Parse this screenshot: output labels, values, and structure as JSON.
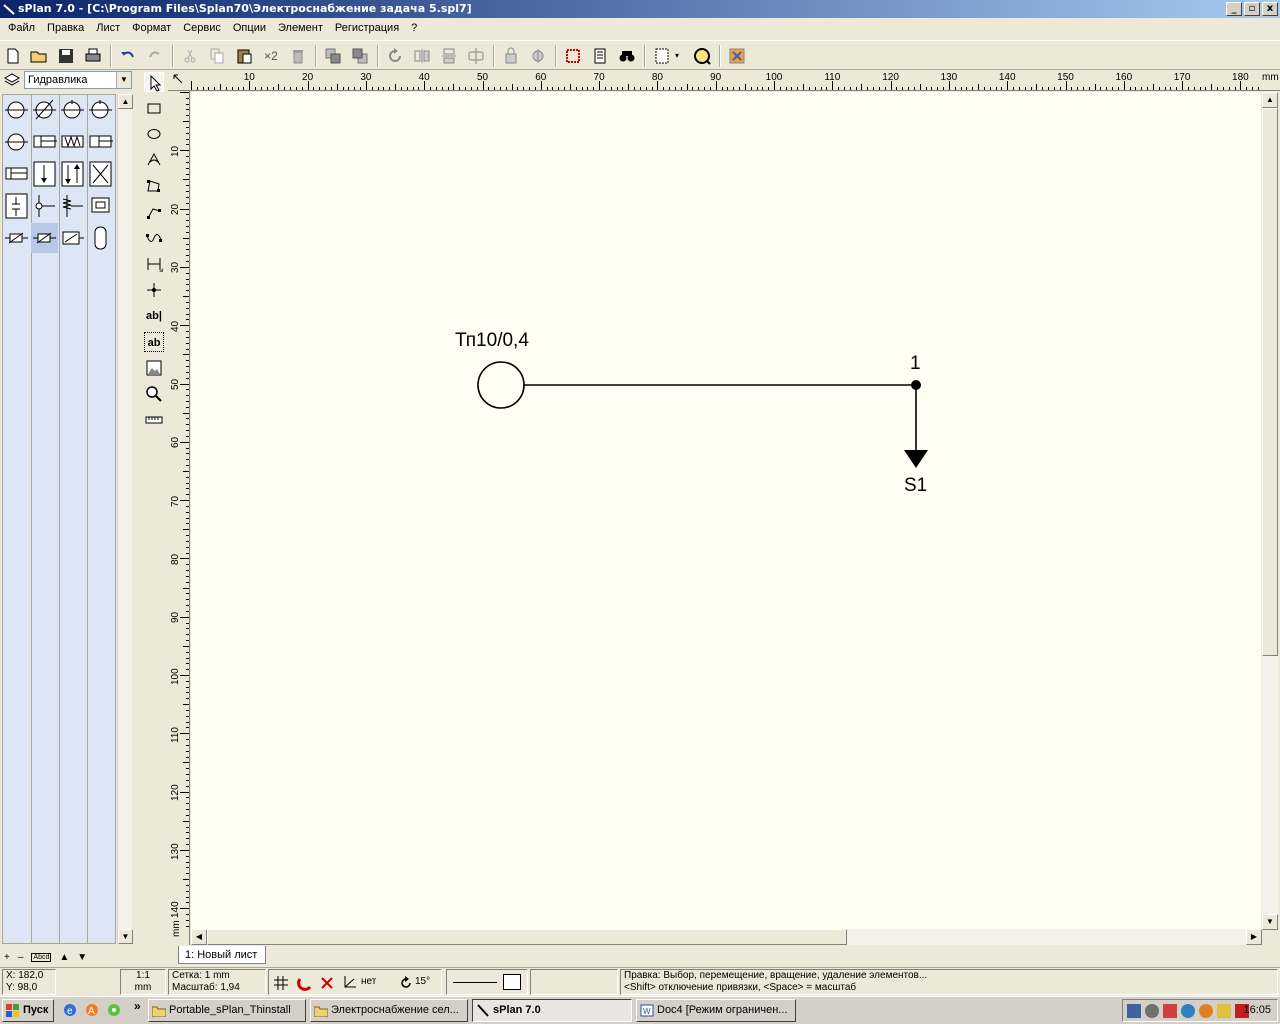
{
  "window": {
    "title": "sPlan 7.0 - [C:\\Program Files\\Splan70\\Электроснабжение задача 5.spl7]",
    "controls": [
      "_",
      "▫",
      "x"
    ]
  },
  "menu": {
    "items": [
      "Файл",
      "Правка",
      "Лист",
      "Формат",
      "Сервис",
      "Опции",
      "Элемент",
      "Регистрация",
      "?"
    ]
  },
  "toolbar": {
    "x2_label": "×2"
  },
  "library": {
    "selected": "Гидравлика",
    "footer": [
      "+",
      "–",
      "Abcd",
      "▲",
      "▼"
    ]
  },
  "drawtools": {
    "text_tool": "ab|",
    "text_tool2": "ab"
  },
  "ruler": {
    "h_labels": [
      "10",
      "20",
      "30",
      "40",
      "50",
      "60",
      "70",
      "80",
      "90",
      "100",
      "110",
      "120",
      "130",
      "140",
      "150",
      "160",
      "170",
      "180"
    ],
    "h_unit": "mm",
    "v_labels": [
      "10",
      "20",
      "30",
      "40",
      "50",
      "60",
      "70",
      "80",
      "90",
      "100",
      "110",
      "120",
      "130",
      "140"
    ],
    "v_unit": "mm"
  },
  "drawing": {
    "source_label": "Тп10/0,4",
    "node_label": "1",
    "load_label": "S1"
  },
  "sheet_tabs": [
    "1: Новый лист"
  ],
  "status": {
    "x": "X: 182,0",
    "y": "Y: 98,0",
    "scale_ratio": "1:1",
    "scale_unit": "mm",
    "grid": "Сетка: 1 mm",
    "zoom": "Масштаб:  1,94",
    "angle_snap": "нет",
    "rotation": "15°",
    "hint_line1": "Правка: Выбор, перемещение, вращение, удаление элементов...",
    "hint_line2": "<Shift> отключение привязки, <Space> = масштаб"
  },
  "taskbar": {
    "start": "Пуск",
    "chevron": "»",
    "tasks": [
      {
        "label": "Portable_sPlan_Thinstall",
        "active": false
      },
      {
        "label": "Электроснабжение сел...",
        "active": false
      },
      {
        "label": "sPlan 7.0",
        "active": true
      },
      {
        "label": "Doc4 [Режим ограничен...",
        "active": false
      }
    ],
    "clock": "16:05"
  }
}
